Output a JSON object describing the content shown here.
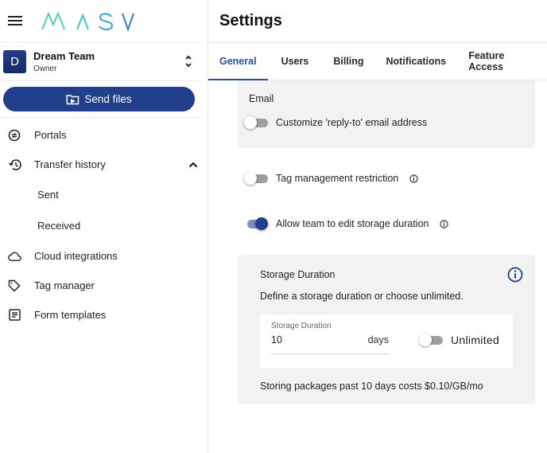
{
  "app": {
    "logo_text": "MASV",
    "logo_colors": [
      "#4fd1b0",
      "#45c4c6",
      "#3c9fd6",
      "#3a7cc4"
    ]
  },
  "sidebar": {
    "team": {
      "avatar_letter": "D",
      "name": "Dream Team",
      "role": "Owner"
    },
    "send_button": {
      "label": "Send files",
      "icon": "send-files-icon"
    },
    "items": [
      {
        "label": "Portals",
        "icon": "portals-icon"
      },
      {
        "label": "Transfer history",
        "icon": "history-icon",
        "expanded": true,
        "children": [
          {
            "label": "Sent"
          },
          {
            "label": "Received"
          }
        ]
      },
      {
        "label": "Cloud integrations",
        "icon": "cloud-icon"
      },
      {
        "label": "Tag manager",
        "icon": "tag-icon"
      },
      {
        "label": "Form templates",
        "icon": "form-icon"
      }
    ]
  },
  "header": {
    "title": "Settings"
  },
  "tabs": [
    {
      "label": "General",
      "active": true
    },
    {
      "label": "Users",
      "active": false
    },
    {
      "label": "Billing",
      "active": false
    },
    {
      "label": "Notifications",
      "active": false
    },
    {
      "label": "Feature Access",
      "active": false
    }
  ],
  "settings": {
    "email": {
      "heading": "Email",
      "reply_to": {
        "label": "Customize 'reply-to' email address",
        "enabled": false
      }
    },
    "tag_restriction": {
      "label": "Tag management restriction",
      "enabled": false
    },
    "edit_storage": {
      "label": "Allow team to edit storage duration",
      "enabled": true
    },
    "storage": {
      "heading": "Storage Duration",
      "description": "Define a storage duration or choose unlimited.",
      "field_label": "Storage Duration",
      "value": "10",
      "unit": "days",
      "unlimited_label": "Unlimited",
      "unlimited_enabled": false,
      "cost_note": "Storing packages past 10 days costs $0.10/GB/mo"
    }
  },
  "colors": {
    "brand": "#213f8a",
    "accent": "#2a4fa0",
    "panel": "#f2f2f2"
  }
}
